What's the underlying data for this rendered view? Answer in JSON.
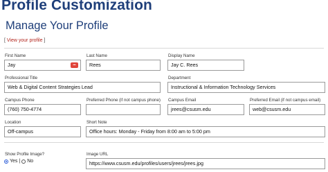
{
  "page": {
    "title": "Profile Customization"
  },
  "section": {
    "title": "Manage Your Profile"
  },
  "view_link": {
    "open": "[ ",
    "label": "View your profile",
    "close": " ]"
  },
  "fields": {
    "first_name": {
      "label": "First Name",
      "value": "Jay"
    },
    "last_name": {
      "label": "Last Name",
      "value": "Rees"
    },
    "display_name": {
      "label": "Display Name",
      "value": "Jay C. Rees"
    },
    "professional_title": {
      "label": "Professional Title",
      "value": "Web & Digital Content Strategies Lead"
    },
    "department": {
      "label": "Department",
      "value": "Instructional & Information Technology Services"
    },
    "campus_phone": {
      "label": "Campus Phone",
      "value": "(760) 750-4774"
    },
    "preferred_phone": {
      "label": "Preferred Phone (if not campus phone)",
      "value": ""
    },
    "campus_email": {
      "label": "Campus Email",
      "value": "jrees@csusm.edu"
    },
    "preferred_email": {
      "label": "Preferred Email (if not campus email)",
      "value": "web@csusm.edu"
    },
    "location": {
      "label": "Location",
      "value": "Off-campus"
    },
    "short_note": {
      "label": "Short Note",
      "value": "Office hours: Monday - Friday from 8:00 am to 5:00 pm"
    },
    "show_image": {
      "label": "Show Profile Image?",
      "yes": "Yes",
      "separator": "|",
      "no": "No",
      "selected": "Yes"
    },
    "image_url": {
      "label": "Image URL",
      "value": "https://www.csusm.edu/profiles/users/jrees/jrees.jpg"
    }
  },
  "icons": {
    "password_manager": "password-manager-icon"
  },
  "colors": {
    "heading": "#1f3f7a",
    "link": "#b3261e",
    "radio": "#2a5bd7"
  }
}
